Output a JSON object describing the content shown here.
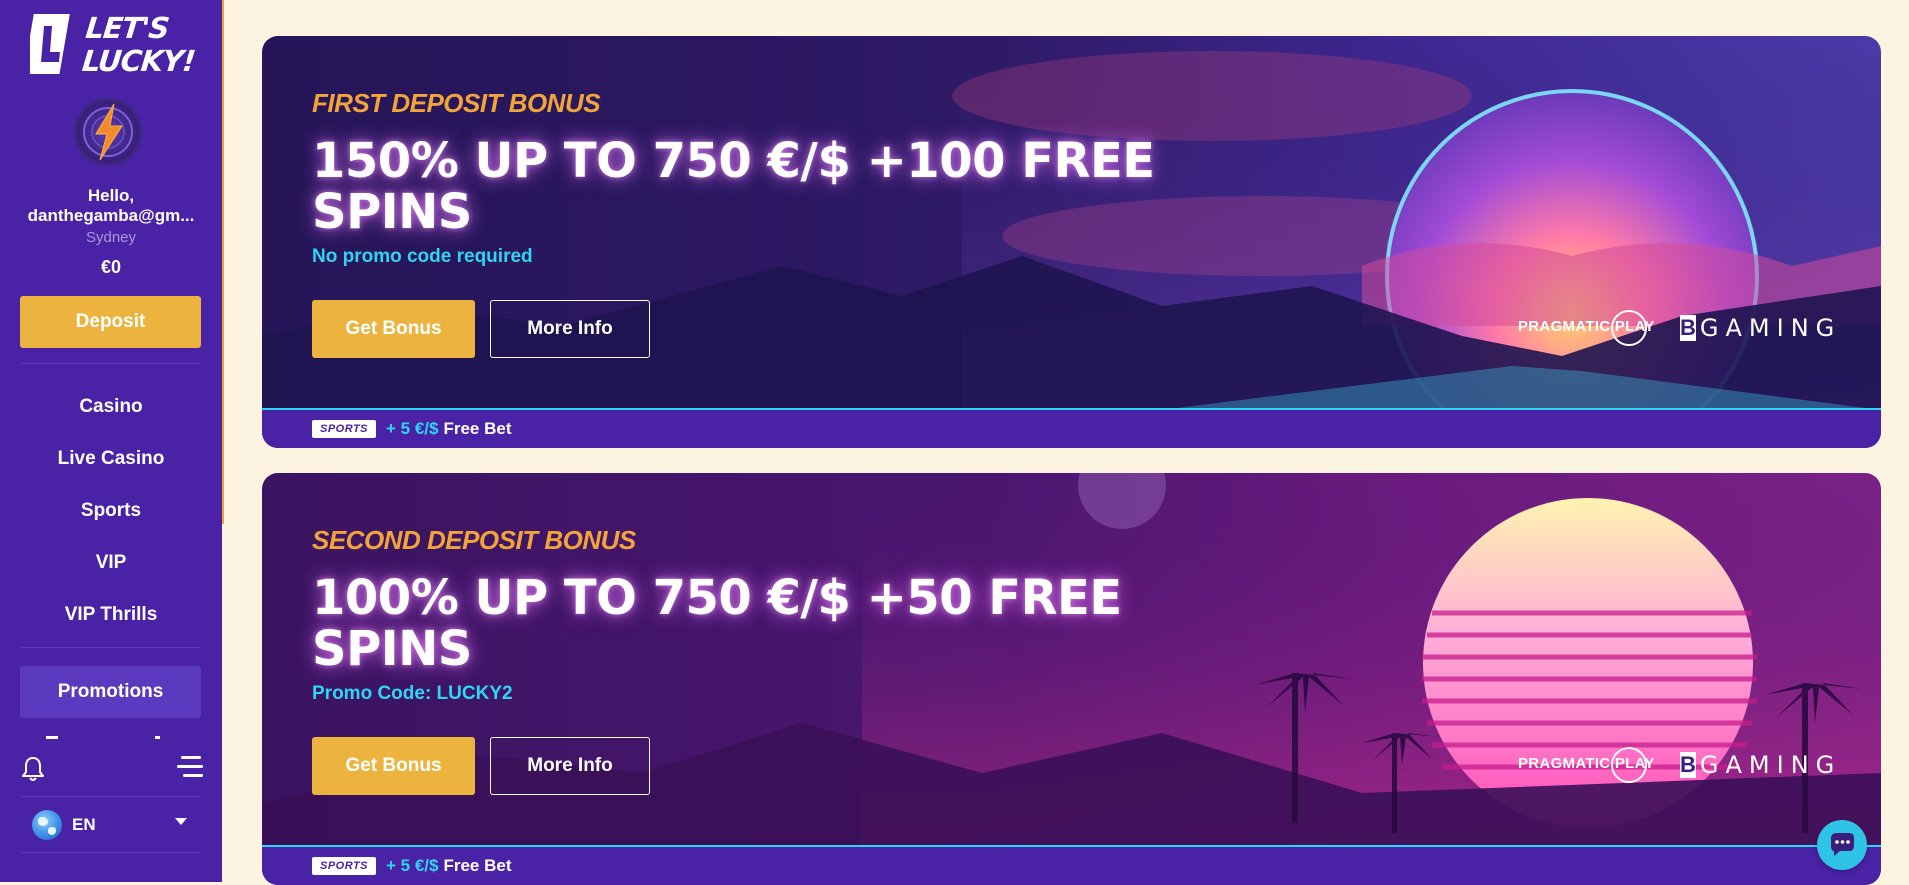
{
  "brand": {
    "logo_text": "LET'S LUCKY!"
  },
  "user": {
    "greeting": "Hello,",
    "email": "danthegamba@gm...",
    "city": "Sydney",
    "balance": "€0"
  },
  "sidebar": {
    "deposit_label": "Deposit",
    "nav": [
      {
        "label": "Casino"
      },
      {
        "label": "Live Casino"
      },
      {
        "label": "Sports"
      },
      {
        "label": "VIP"
      },
      {
        "label": "VIP Thrills"
      }
    ],
    "active_item": "Promotions",
    "language": "EN"
  },
  "banners": [
    {
      "eyebrow": "FIRST DEPOSIT BONUS",
      "headline": "150% UP TO 750 €/$ +100 FREE SPINS",
      "promo": "No promo code required",
      "get_label": "Get Bonus",
      "more_label": "More Info",
      "providers": {
        "pragmatic": "PRAGMATIC PLAY",
        "bgaming": "GAMING",
        "bgaming_mark": "B"
      },
      "sports_badge": "SPORTS",
      "sports_amount": "+ 5 €/$",
      "sports_text": "Free Bet"
    },
    {
      "eyebrow": "SECOND DEPOSIT BONUS",
      "headline": "100% UP TO 750 €/$ +50 FREE SPINS",
      "promo": "Promo Code: LUCKY2",
      "get_label": "Get Bonus",
      "more_label": "More Info",
      "providers": {
        "pragmatic": "PRAGMATIC PLAY",
        "bgaming": "GAMING",
        "bgaming_mark": "B"
      },
      "sports_badge": "SPORTS",
      "sports_amount": "+ 5 €/$",
      "sports_text": "Free Bet"
    }
  ],
  "colors": {
    "sidebar_bg": "#4a22a6",
    "accent_gold": "#ecb43e",
    "accent_cyan": "#2fd6f2",
    "page_bg": "#fdf3e1"
  }
}
